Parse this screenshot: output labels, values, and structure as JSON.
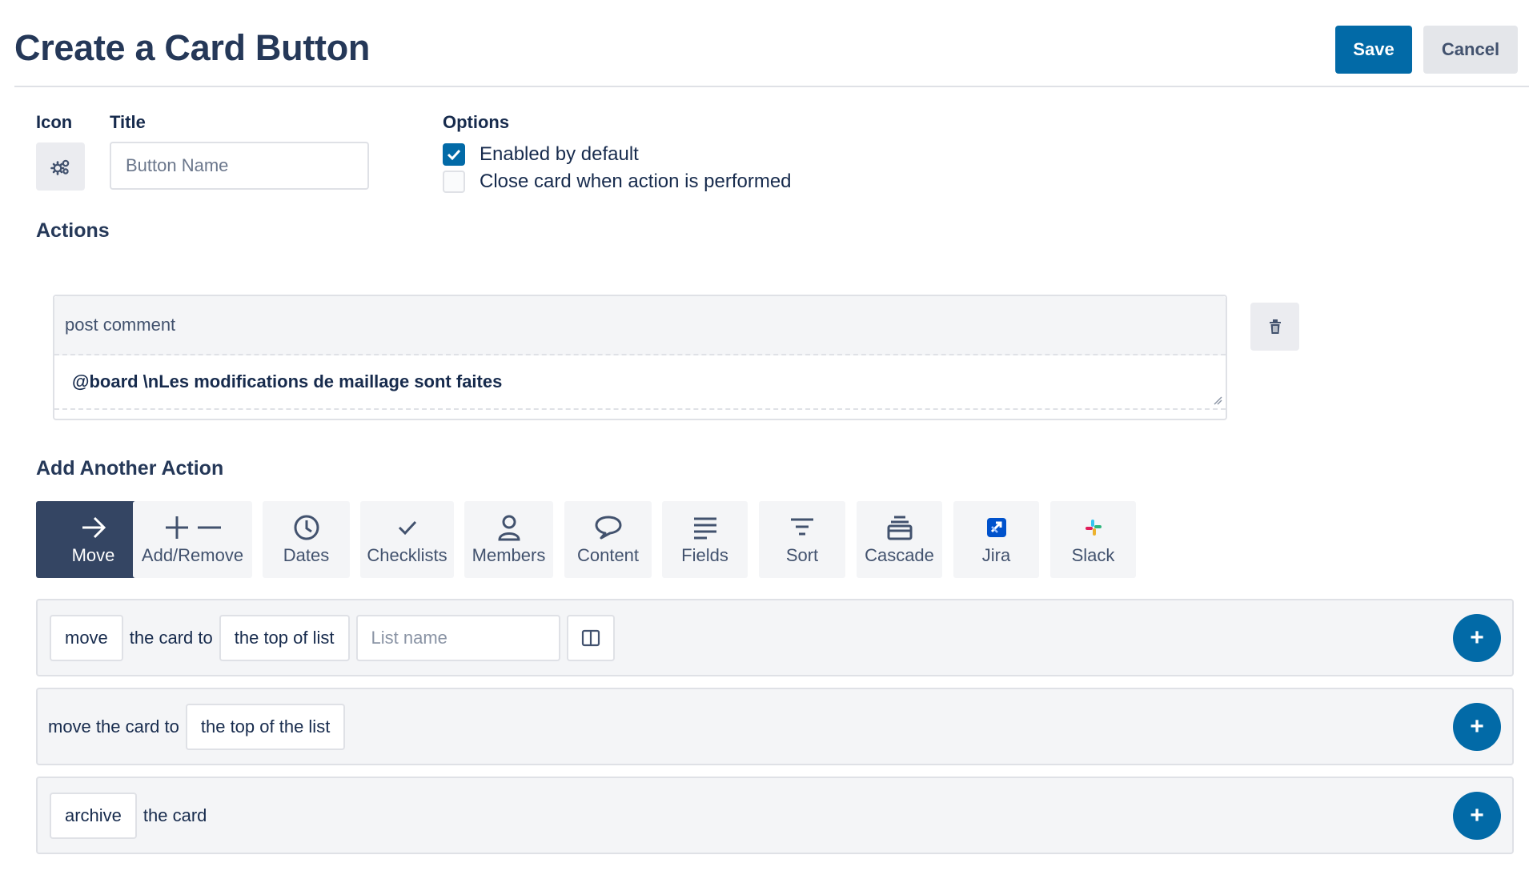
{
  "header": {
    "title": "Create a Card Button",
    "save_label": "Save",
    "cancel_label": "Cancel"
  },
  "form": {
    "icon_label": "Icon",
    "icon_name": "gears-icon",
    "title_label": "Title",
    "title_placeholder": "Button Name",
    "title_value": "",
    "options_label": "Options",
    "options": [
      {
        "label": "Enabled by default",
        "checked": true
      },
      {
        "label": "Close card when action is performed",
        "checked": false
      }
    ]
  },
  "actions": {
    "label": "Actions",
    "items": [
      {
        "type": "post comment",
        "text": "@board \\nLes modifications de maillage sont faites"
      }
    ]
  },
  "add_action": {
    "label": "Add Another Action",
    "tabs": [
      {
        "label": "Move",
        "icon": "arrow-right-icon",
        "active": true
      },
      {
        "label": "Add/Remove",
        "icon": "plus-minus-icon",
        "active": false
      },
      {
        "label": "Dates",
        "icon": "clock-icon",
        "active": false
      },
      {
        "label": "Checklists",
        "icon": "check-icon",
        "active": false
      },
      {
        "label": "Members",
        "icon": "person-icon",
        "active": false
      },
      {
        "label": "Content",
        "icon": "speech-bubble-icon",
        "active": false
      },
      {
        "label": "Fields",
        "icon": "lines-icon",
        "active": false
      },
      {
        "label": "Sort",
        "icon": "sort-icon",
        "active": false
      },
      {
        "label": "Cascade",
        "icon": "cascade-icon",
        "active": false
      },
      {
        "label": "Jira",
        "icon": "jira-icon",
        "active": false
      },
      {
        "label": "Slack",
        "icon": "slack-icon",
        "active": false
      }
    ],
    "rows": [
      {
        "verb": "move",
        "text1": "the card to",
        "position": "the top of list",
        "list_placeholder": "List name"
      },
      {
        "text1": "move the card to",
        "position": "the top of the list"
      },
      {
        "verb": "archive",
        "text1": "the card"
      }
    ]
  },
  "colors": {
    "primary": "#026aa7",
    "active_tab": "#344563",
    "border": "#dfe1e6"
  }
}
